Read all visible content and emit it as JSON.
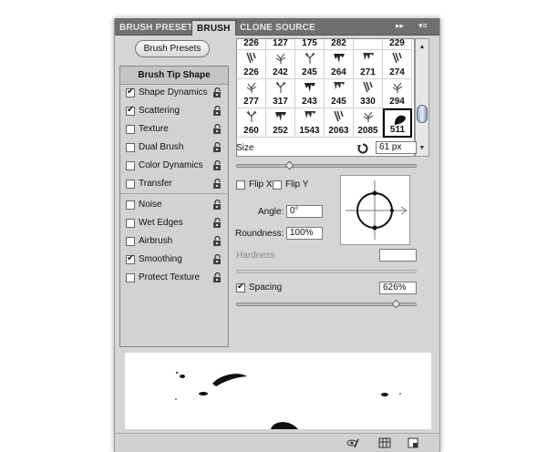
{
  "tabs": [
    {
      "label": "BRUSH PRESETS",
      "active": false
    },
    {
      "label": "BRUSH",
      "active": true
    },
    {
      "label": "CLONE SOURCE",
      "active": false
    }
  ],
  "tab_controls": {
    "collapse": "▸▸",
    "menu": "▾≡"
  },
  "presets_button": "Brush Presets",
  "list_header": "Brush Tip Shape",
  "options": [
    {
      "label": "Shape Dynamics",
      "checked": true
    },
    {
      "label": "Scattering",
      "checked": true
    },
    {
      "label": "Texture",
      "checked": false
    },
    {
      "label": "Dual Brush",
      "checked": false
    },
    {
      "label": "Color Dynamics",
      "checked": false
    },
    {
      "label": "Transfer",
      "checked": false
    },
    {
      "label": "Noise",
      "checked": false
    },
    {
      "label": "Wet Edges",
      "checked": false
    },
    {
      "label": "Airbrush",
      "checked": false
    },
    {
      "label": "Smoothing",
      "checked": true
    },
    {
      "label": "Protect Texture",
      "checked": false
    }
  ],
  "brush_rows": [
    [
      "226",
      "127",
      "175",
      "282",
      "",
      "229"
    ],
    [
      "226",
      "242",
      "245",
      "264",
      "271",
      "274"
    ],
    [
      "277",
      "317",
      "243",
      "245",
      "330",
      "294"
    ],
    [
      "260",
      "252",
      "1543",
      "2063",
      "2085",
      "511"
    ]
  ],
  "selected_brush": "511",
  "size": {
    "label": "Size",
    "value": "61 px",
    "fraction": 0.3
  },
  "flip_x": {
    "label": "Flip X",
    "checked": false
  },
  "flip_y": {
    "label": "Flip Y",
    "checked": false
  },
  "angle": {
    "label": "Angle:",
    "value": "0°"
  },
  "roundness": {
    "label": "Roundness:",
    "value": "100%"
  },
  "hardness": {
    "label": "Hardness",
    "value": ""
  },
  "spacing": {
    "label": "Spacing",
    "checked": true,
    "value": "626%",
    "fraction": 0.89
  },
  "colors": {
    "panel_bg": "#d5d5d5",
    "tab_bar": "#6f6f6f",
    "scroll_thumb": "#9aa9c0"
  }
}
